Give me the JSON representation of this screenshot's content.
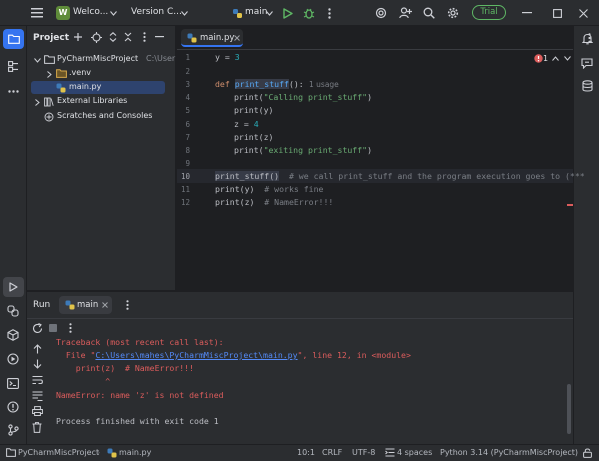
{
  "titlebar": {
    "project_badge": "W",
    "project_name": "Welco...",
    "vcs": "Version C...",
    "run_config": "main",
    "trial": "Trial"
  },
  "project_panel": {
    "title": "Project",
    "items": [
      {
        "label": "PyCharmMiscProject",
        "suffix": "C:\\User"
      },
      {
        "label": ".venv"
      },
      {
        "label": "main.py"
      },
      {
        "label": "External Libraries"
      },
      {
        "label": "Scratches and Consoles"
      }
    ]
  },
  "editor": {
    "tab_label": "main.py",
    "error_count": "1",
    "line_numbers": [
      "1",
      "2",
      "3",
      "4",
      "5",
      "6",
      "7",
      "8",
      "9",
      "10",
      "11",
      "12"
    ],
    "usage_hint": "1 usage",
    "lines": {
      "l1_var": "y",
      "l1_eq": " = ",
      "l1_num": "3",
      "l3_def": "def ",
      "l3_name": "print_stuff",
      "l3_rest": "():",
      "l4_fn": "print(",
      "l4_str": "\"Calling print_stuff\"",
      "l4_end": ")",
      "l5": "print(y)",
      "l6_var": "z",
      "l6_eq": " = ",
      "l6_num": "4",
      "l7": "print(z)",
      "l8_fn": "print(",
      "l8_str": "\"exiting print_stuff\"",
      "l8_end": ")",
      "l10_code": "print_stuff()",
      "l10_comment": "  # we call print_stuff and the program execution goes to (***",
      "l11_code": "print(y)",
      "l11_comment": "  # works fine",
      "l12_code": "print(z)",
      "l12_comment": "  # NameError!!!"
    }
  },
  "run_panel": {
    "title": "Run",
    "tab_label": "main",
    "output": {
      "traceback": "Traceback (most recent call last):",
      "file_prefix": "  File \"",
      "file_link": "C:\\Users\\mahes\\PyCharmMiscProject\\main.py",
      "file_suffix": "\", line 12, in <module>",
      "code_line": "    print(z)  # NameError!!!",
      "caret": "          ^",
      "error": "NameError: name 'z' is not defined",
      "finished": "Process finished with exit code 1"
    }
  },
  "statusbar": {
    "breadcrumb_project": "PyCharmMiscProject",
    "breadcrumb_file": "main.py",
    "position": "10:1",
    "line_ending": "CRLF",
    "encoding": "UTF-8",
    "indent": "4 spaces",
    "interpreter": "Python 3.14 (PyCharmMiscProject)"
  },
  "colors": {
    "accent": "#3574f0",
    "error": "#db5c5c",
    "keyword": "#cf8e6d",
    "string": "#6aab73",
    "number": "#2aacb8",
    "comment": "#7a7e85",
    "link": "#548af7",
    "trial": "#5fb865"
  },
  "icons": [
    "menu-icon",
    "chevron-down-icon",
    "run-icon",
    "debug-icon",
    "more-icon",
    "ai-icon",
    "add-user-icon",
    "search-icon",
    "settings-icon",
    "minimize-icon",
    "maximize-icon",
    "close-icon",
    "folder-icon",
    "structure-icon",
    "python-file-icon",
    "bell-icon",
    "database-icon",
    "rerun-icon",
    "stop-icon",
    "terminal-icon",
    "problems-icon",
    "git-icon"
  ]
}
